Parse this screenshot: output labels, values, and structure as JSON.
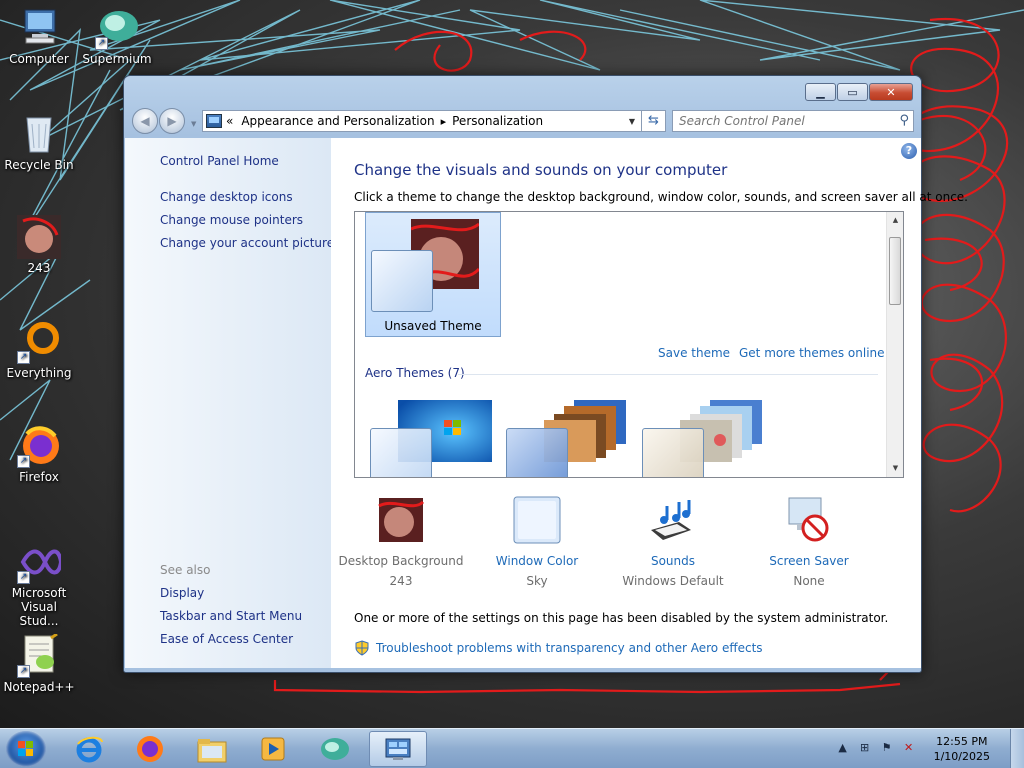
{
  "desktop": {
    "icons": [
      {
        "label": "Computer"
      },
      {
        "label": "Supermium"
      },
      {
        "label": "Recycle Bin"
      },
      {
        "label": "243"
      },
      {
        "label": "Everything"
      },
      {
        "label": "Firefox"
      },
      {
        "label": "Microsoft Visual Stud..."
      },
      {
        "label": "Notepad++"
      }
    ]
  },
  "window": {
    "controls": {
      "minimize": "▁",
      "maximize": "▭",
      "close": "✕"
    },
    "address": {
      "overflow": "«",
      "crumbs": [
        "Appearance and Personalization",
        "Personalization"
      ],
      "separator": "▸"
    },
    "search": {
      "placeholder": "Search Control Panel"
    },
    "left_pane": {
      "home": "Control Panel Home",
      "links": [
        "Change desktop icons",
        "Change mouse pointers",
        "Change your account picture"
      ],
      "see_also_heading": "See also",
      "see_also": [
        "Display",
        "Taskbar and Start Menu",
        "Ease of Access Center"
      ]
    },
    "content": {
      "title": "Change the visuals and sounds on your computer",
      "description": "Click a theme to change the desktop background, window color, sounds, and screen saver all at once.",
      "selected_theme": "Unsaved Theme",
      "save_theme": "Save theme",
      "get_more": "Get more themes online",
      "aero_heading": "Aero Themes (7)",
      "settings": [
        {
          "name": "Desktop Background",
          "value": "243",
          "enabled": false
        },
        {
          "name": "Window Color",
          "value": "Sky",
          "enabled": true
        },
        {
          "name": "Sounds",
          "value": "Windows Default",
          "enabled": true
        },
        {
          "name": "Screen Saver",
          "value": "None",
          "enabled": true
        }
      ],
      "notice": "One or more of the settings on this page has been disabled by the system administrator.",
      "troubleshoot": "Troubleshoot problems with transparency and other Aero effects"
    }
  },
  "taskbar": {
    "clock_time": "12:55 PM",
    "clock_date": "1/10/2025"
  }
}
